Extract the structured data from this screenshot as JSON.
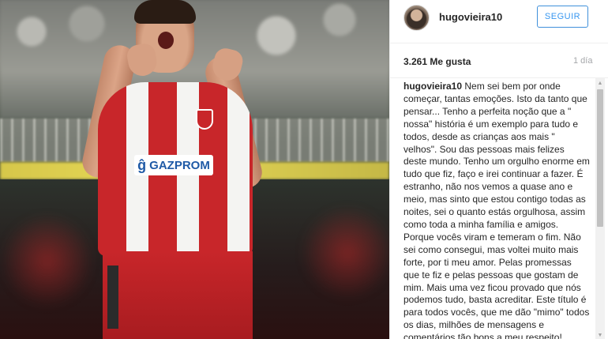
{
  "post": {
    "username": "hugovieira10",
    "follow_label": "SEGUIR",
    "likes": "3.261 Me gusta",
    "age": "1 día",
    "caption_user": "hugovieira10",
    "caption_text": "Nem sei bem por onde começar, tantas emoções. Isto da tanto que pensar... Tenho a perfeita noção que a \" nossa\" história é um exemplo para tudo e todos, desde as crianças aos mais \" velhos\". Sou das pessoas mais felizes deste mundo. Tenho um orgulho enorme em tudo que fiz, faço e irei continuar a fazer. É estranho, não nos vemos a quase ano e meio, mas sinto que estou contigo todas as noites, sei o quanto estás orgulhosa, assim como toda a minha família e amigos. Porque vocês viram e temeram o fim. Não sei como consegui, mas voltei muito mais forte, por ti meu amor. Pelas promessas que te fiz e pelas pessoas que gostam de mim. Mais uma vez ficou provado que nós podemos tudo, basta acreditar. Este título é para todos vocês, que me dão \"mimo\" todos os dias, milhões de mensagens e comentários tão bons a meu respeito!"
  },
  "photo": {
    "sponsor_text": "GAZPROM"
  },
  "icons": {
    "scroll_up": "scroll-up-arrow-icon",
    "scroll_down": "scroll-down-arrow-icon",
    "avatar": "profile-avatar"
  },
  "colors": {
    "follow_blue": "#3897f0",
    "shirt_red": "#c8262a",
    "muted_text": "#a5a7aa"
  }
}
